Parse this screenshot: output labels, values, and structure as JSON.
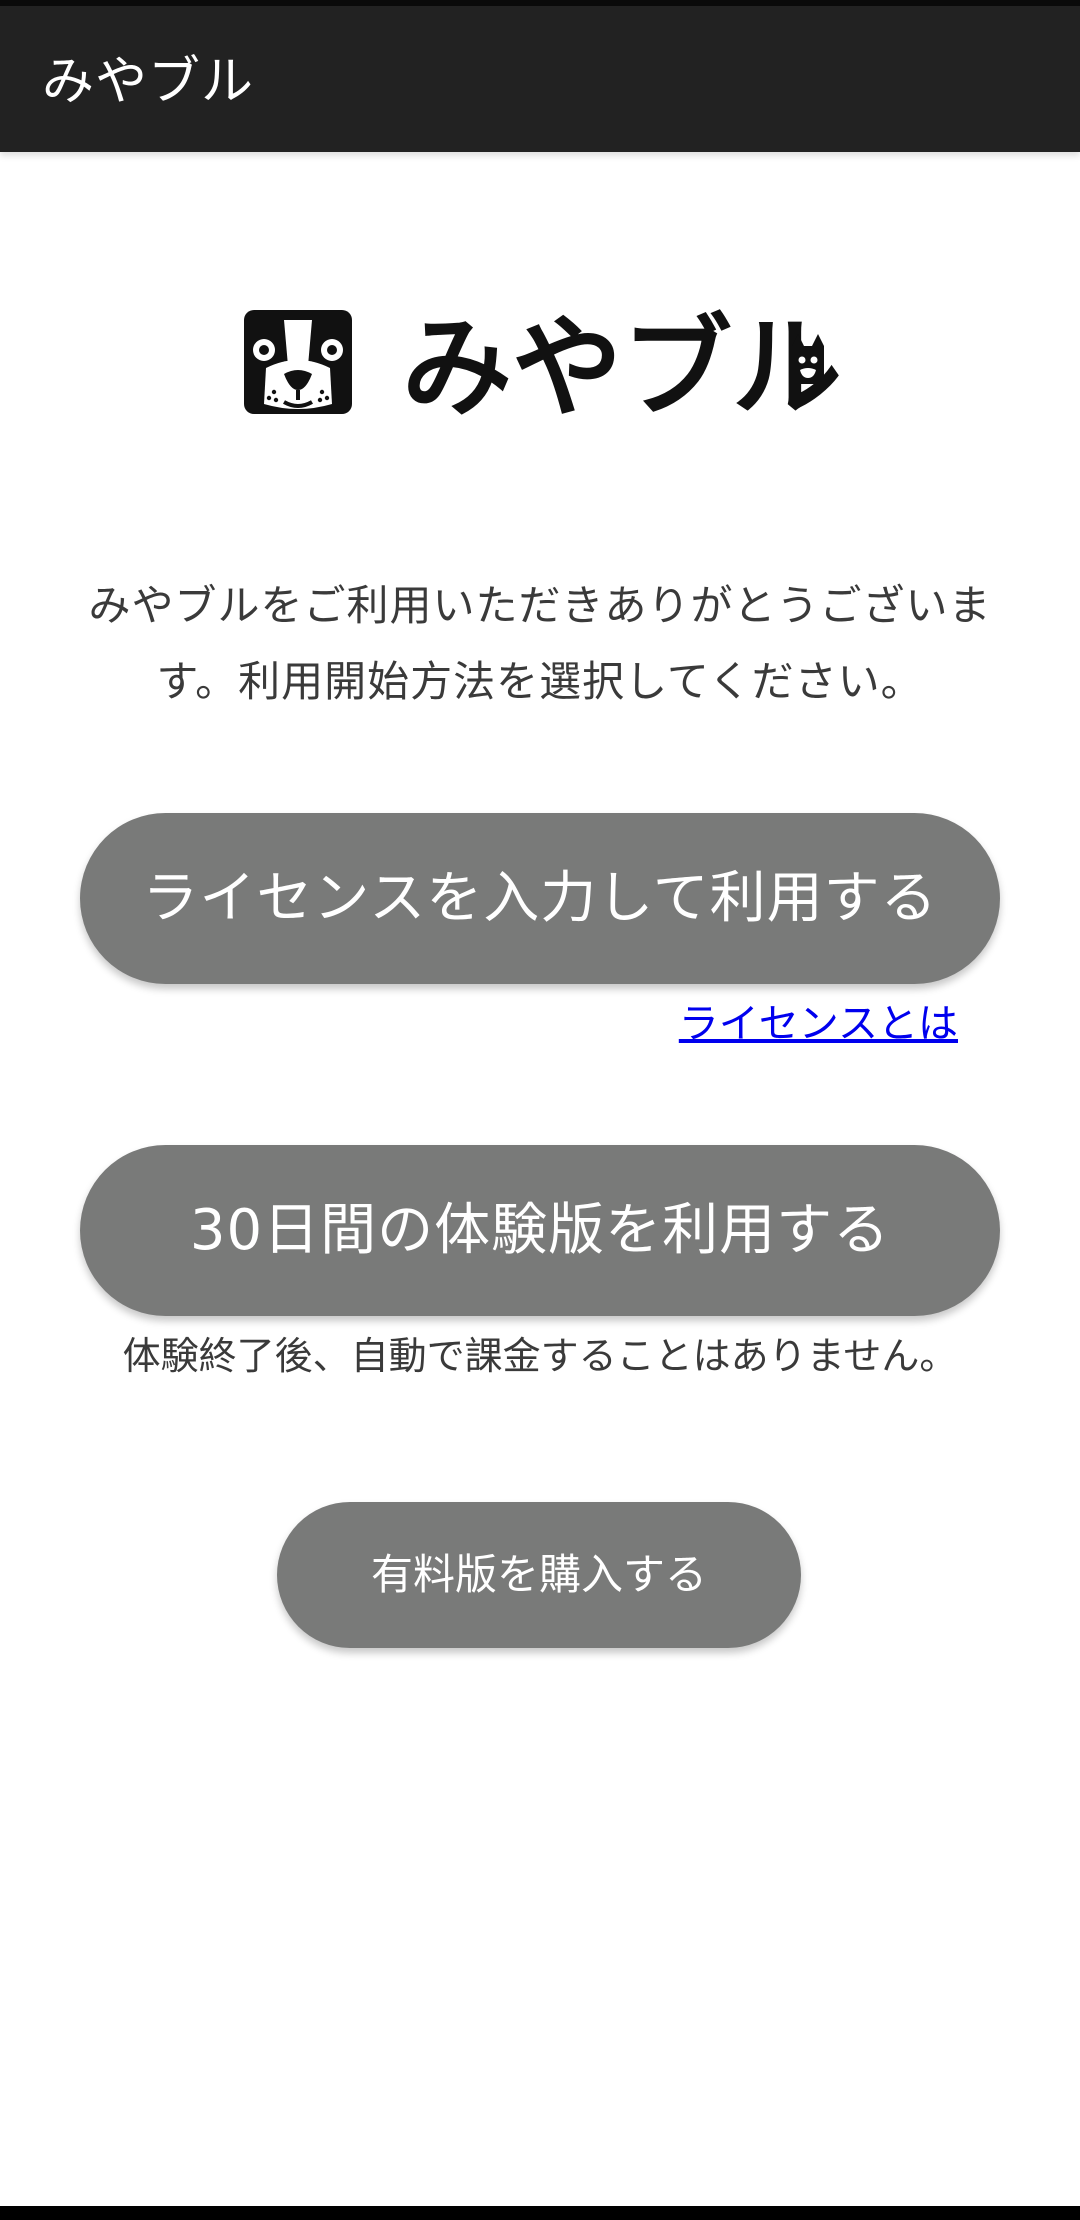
{
  "app_bar": {
    "title": "みやブル"
  },
  "logo": {
    "text": "みやブル",
    "icon": "bulldog-face-icon"
  },
  "intro": {
    "message": "みやブルをご利用いただきありがとうございます。利用開始方法を選択してください。"
  },
  "actions": {
    "license_button": "ライセンスを入力して利用する",
    "license_link": "ライセンスとは",
    "trial_button": "30日間の体験版を利用する",
    "trial_note": "体験終了後、自動で課金することはありません。",
    "buy_button": "有料版を購入する"
  },
  "colors": {
    "app_bar": "#222222",
    "button": "#797a79",
    "link": "#0000ee",
    "text": "#3a3a3a"
  }
}
